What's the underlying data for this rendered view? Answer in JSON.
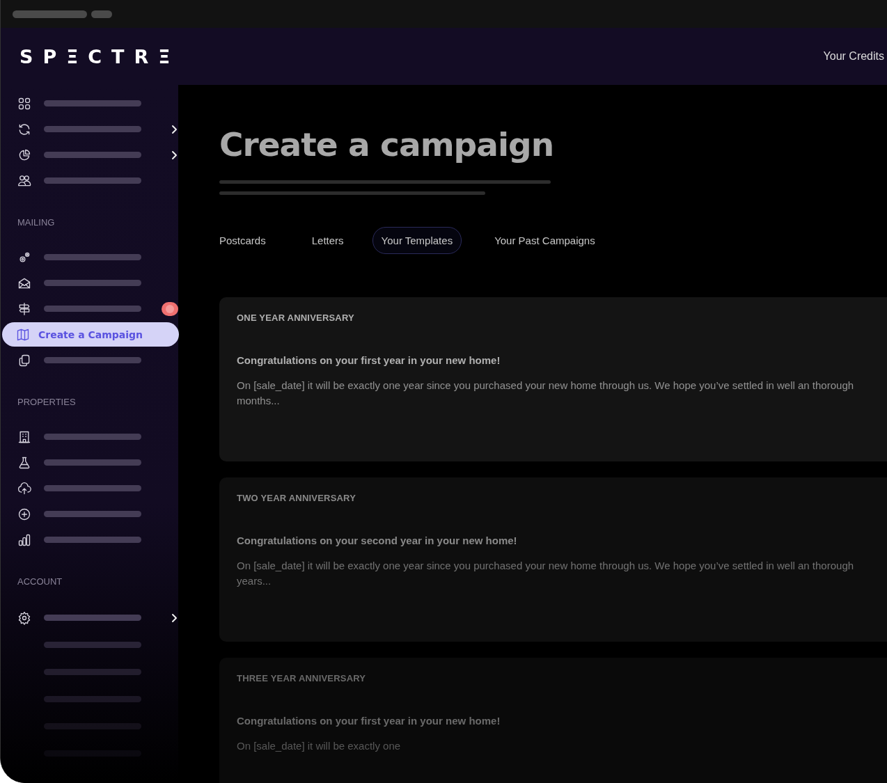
{
  "header": {
    "logo": "SPΞCTRΞ",
    "credits_link": "Your Credits"
  },
  "sidebar": {
    "sections": [
      {
        "items": [
          {
            "kind": "grid",
            "selected": false,
            "has_submenu": false,
            "badge": false
          },
          {
            "kind": "refresh",
            "selected": false,
            "has_submenu": true,
            "badge": false
          },
          {
            "kind": "pie",
            "selected": false,
            "has_submenu": true,
            "badge": false
          },
          {
            "kind": "users",
            "selected": false,
            "has_submenu": false,
            "badge": false
          }
        ]
      },
      {
        "heading": "MAILING",
        "items": [
          {
            "kind": "gears",
            "selected": false,
            "has_submenu": false,
            "badge": false
          },
          {
            "kind": "mail",
            "selected": false,
            "has_submenu": false,
            "badge": false
          },
          {
            "kind": "signpost",
            "selected": false,
            "has_submenu": false,
            "badge": true
          },
          {
            "kind": "map",
            "label": "Create a Campaign",
            "selected": true,
            "has_submenu": false,
            "badge": false
          },
          {
            "kind": "copy",
            "selected": false,
            "has_submenu": false,
            "badge": false
          }
        ]
      },
      {
        "heading": "PROPERTIES",
        "items": [
          {
            "kind": "building",
            "selected": false,
            "has_submenu": false,
            "badge": false
          },
          {
            "kind": "flask",
            "selected": false,
            "has_submenu": false,
            "badge": false
          },
          {
            "kind": "upload",
            "selected": false,
            "has_submenu": false,
            "badge": false
          },
          {
            "kind": "plus",
            "selected": false,
            "has_submenu": false,
            "badge": false
          },
          {
            "kind": "bars",
            "selected": false,
            "has_submenu": false,
            "badge": false
          }
        ]
      },
      {
        "heading": "ACCOUNT",
        "items": [
          {
            "kind": "gear",
            "selected": false,
            "has_submenu": true,
            "badge": false
          },
          {
            "kind": "blank",
            "selected": false,
            "has_submenu": false,
            "badge": false
          },
          {
            "kind": "blank",
            "selected": false,
            "has_submenu": false,
            "badge": false
          },
          {
            "kind": "blank",
            "selected": false,
            "has_submenu": false,
            "badge": false
          },
          {
            "kind": "blank",
            "selected": false,
            "has_submenu": false,
            "badge": false
          },
          {
            "kind": "blank",
            "selected": false,
            "has_submenu": false,
            "badge": false
          }
        ]
      }
    ]
  },
  "main": {
    "title": "Create a campaign",
    "tabs": [
      {
        "label": "Postcards",
        "selected": false
      },
      {
        "label": "Letters",
        "selected": false
      },
      {
        "label": "Your Templates",
        "selected": true
      },
      {
        "label": "Your Past Campaigns",
        "selected": false
      }
    ],
    "templates": [
      {
        "label": "ONE YEAR ANNIVERSARY",
        "heading": "Congratulations on your first year in your new home!",
        "body_lines": [
          "On [sale_date] it will be exactly one year since you purchased your new home through us. We hope you’ve settled in well an thorough",
          "months..."
        ]
      },
      {
        "label": "TWO YEAR ANNIVERSARY",
        "heading": "Congratulations on your second year in your new home!",
        "body_lines": [
          "On [sale_date] it will be exactly one year since you purchased your new home through us. We hope you’ve settled in well an thorough",
          "years..."
        ]
      },
      {
        "label": "THREE YEAR ANNIVERSARY",
        "heading": "Congratulations on your first year in your new home!",
        "body_lines": [
          "On [sale_date] it will be exactly one"
        ]
      }
    ]
  }
}
